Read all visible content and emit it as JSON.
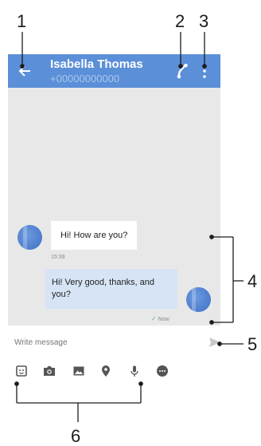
{
  "callouts": [
    "1",
    "2",
    "3",
    "4",
    "5",
    "6"
  ],
  "header": {
    "contact_name": "Isabella Thomas",
    "contact_number": "+00000000000"
  },
  "thread": {
    "incoming": {
      "text": "Hi! How are you?",
      "time": "15:39"
    },
    "outgoing": {
      "text": "Hi! Very good, thanks, and you?",
      "status": "Now"
    }
  },
  "compose": {
    "placeholder": "Write message"
  },
  "toolbar_icons": [
    "sticker-icon",
    "camera-icon",
    "image-icon",
    "location-icon",
    "microphone-icon",
    "more-icon"
  ],
  "colors": {
    "accent": "#5b8fd8",
    "thread_bg": "#e8e8e8",
    "outgoing_bubble": "#d6e4f5"
  }
}
